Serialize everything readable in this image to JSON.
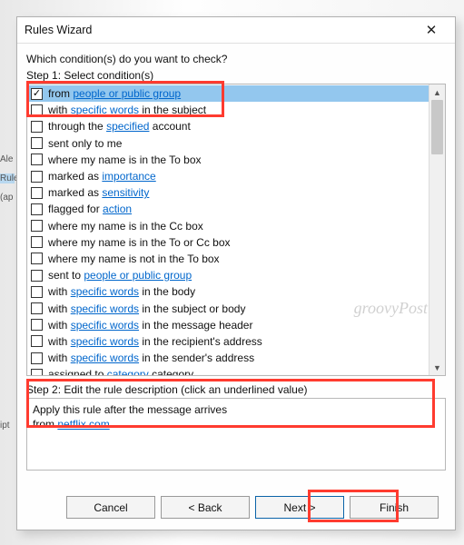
{
  "dialog": {
    "title": "Rules Wizard",
    "prompt": "Which condition(s) do you want to check?",
    "step1_label": "Step 1: Select condition(s)",
    "step2_label": "Step 2: Edit the rule description (click an underlined value)"
  },
  "conditions": [
    {
      "checked": true,
      "selected": true,
      "pre": "from ",
      "link": "people or public group",
      "post": ""
    },
    {
      "checked": false,
      "pre": "with ",
      "link": "specific words",
      "post": " in the subject"
    },
    {
      "checked": false,
      "pre": "through the ",
      "link": "specified",
      "post": " account"
    },
    {
      "checked": false,
      "pre": "sent only to me",
      "link": "",
      "post": ""
    },
    {
      "checked": false,
      "pre": "where my name is in the To box",
      "link": "",
      "post": ""
    },
    {
      "checked": false,
      "pre": "marked as ",
      "link": "importance",
      "post": ""
    },
    {
      "checked": false,
      "pre": "marked as ",
      "link": "sensitivity",
      "post": ""
    },
    {
      "checked": false,
      "pre": "flagged for ",
      "link": "action",
      "post": ""
    },
    {
      "checked": false,
      "pre": "where my name is in the Cc box",
      "link": "",
      "post": ""
    },
    {
      "checked": false,
      "pre": "where my name is in the To or Cc box",
      "link": "",
      "post": ""
    },
    {
      "checked": false,
      "pre": "where my name is not in the To box",
      "link": "",
      "post": ""
    },
    {
      "checked": false,
      "pre": "sent to ",
      "link": "people or public group",
      "post": ""
    },
    {
      "checked": false,
      "pre": "with ",
      "link": "specific words",
      "post": " in the body"
    },
    {
      "checked": false,
      "pre": "with ",
      "link": "specific words",
      "post": " in the subject or body"
    },
    {
      "checked": false,
      "pre": "with ",
      "link": "specific words",
      "post": " in the message header"
    },
    {
      "checked": false,
      "pre": "with ",
      "link": "specific words",
      "post": " in the recipient's address"
    },
    {
      "checked": false,
      "pre": "with ",
      "link": "specific words",
      "post": " in the sender's address"
    },
    {
      "checked": false,
      "pre": "assigned to ",
      "link": "category",
      "post": " category"
    }
  ],
  "description": {
    "line1": "Apply this rule after the message arrives",
    "line2_pre": "from ",
    "line2_link": "netflix.com"
  },
  "buttons": {
    "cancel": "Cancel",
    "back": "< Back",
    "next": "Next >",
    "finish": "Finish"
  },
  "sidebar": {
    "ale": "Ale",
    "rule": "Rule",
    "ap": "(ap",
    "ipt": "ipt"
  },
  "watermark": "groovyPost"
}
